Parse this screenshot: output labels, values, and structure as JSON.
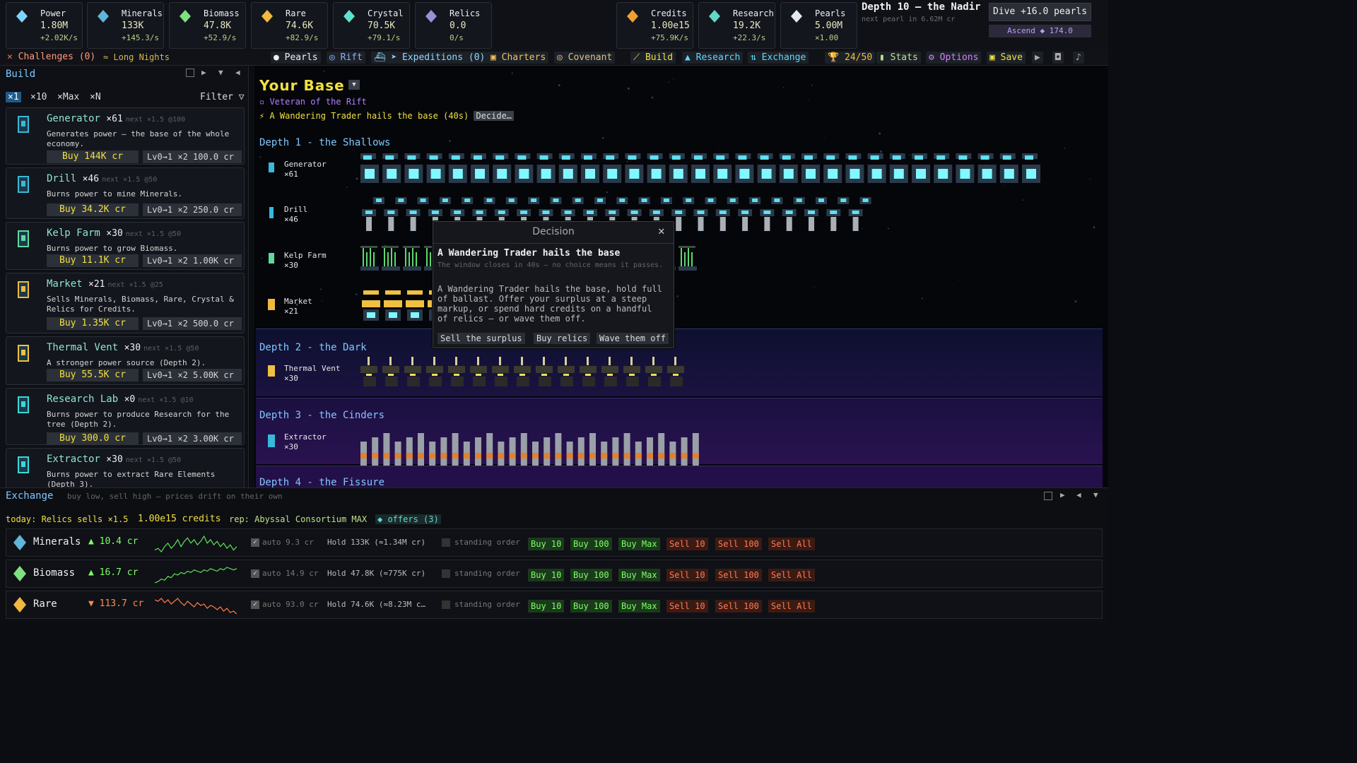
{
  "resources": [
    {
      "name": "Power",
      "value": "1.80M",
      "rate": "+2.02K/s",
      "icon": "lightning-icon",
      "color": "#7fd4ff"
    },
    {
      "name": "Minerals",
      "value": "133K",
      "rate": "+145.3/s",
      "icon": "mineral-crystal-icon",
      "color": "#5fb6d8"
    },
    {
      "name": "Biomass",
      "value": "47.8K",
      "rate": "+52.9/s",
      "icon": "kelp-icon",
      "color": "#7fe07f"
    },
    {
      "name": "Rare",
      "value": "74.6K",
      "rate": "+82.9/s",
      "icon": "rare-orb-icon",
      "color": "#f0b840"
    },
    {
      "name": "Crystal",
      "value": "70.5K",
      "rate": "+79.1/s",
      "icon": "crystal-icon",
      "color": "#5fe0d0"
    },
    {
      "name": "Relics",
      "value": "0.0",
      "rate": "0/s",
      "icon": "relic-icon",
      "color": "#9a8fd8"
    },
    {
      "name": "Credits",
      "value": "1.00e15",
      "rate": "+75.9K/s",
      "icon": "credit-coin-icon",
      "color": "#f0a030"
    },
    {
      "name": "Research",
      "value": "19.2K",
      "rate": "+22.3/s",
      "icon": "flask-icon",
      "color": "#5fd8c8"
    },
    {
      "name": "Pearls",
      "value": "5.00M",
      "rate": "×1.00",
      "icon": "pearl-icon",
      "color": "#e0e8f0"
    }
  ],
  "depth": {
    "title": "Depth 10 — the Nadir",
    "next": "next pearl in 6.62M cr",
    "dive": "Dive  +16.0 pearls",
    "ascend": "Ascend  ◆ 174.0"
  },
  "subbar": {
    "challenges": "Challenges (0)",
    "long_nights": "≈ Long Nights",
    "pearls": "Pearls",
    "rift": "Rift",
    "expeditions": "Expeditions (0)",
    "charters": "Charters",
    "covenant": "Covenant",
    "build": "Build",
    "research": "Research",
    "exchange": "Exchange",
    "trophies": "24/50",
    "stats": "Stats",
    "options": "Options",
    "save": "Save"
  },
  "build_panel": {
    "title": "Build",
    "multipliers": [
      "×1",
      "×10",
      "×Max",
      "×N"
    ],
    "filter": "Filter ▽",
    "cards": [
      {
        "name": "Generator",
        "count": "×61",
        "next": "next ×1.5 @100",
        "desc": "Generates power — the base of the whole economy.",
        "buy": "Buy 144K cr",
        "lv": "Lv0→1 ×2  100.0 cr",
        "icon": "generator-icon"
      },
      {
        "name": "Drill",
        "count": "×46",
        "next": "next ×1.5 @50",
        "desc": "Burns power to mine Minerals.",
        "buy": "Buy 34.2K cr",
        "lv": "Lv0→1 ×2  250.0 cr",
        "icon": "drill-icon"
      },
      {
        "name": "Kelp Farm",
        "count": "×30",
        "next": "next ×1.5 @50",
        "desc": "Burns power to grow Biomass.",
        "buy": "Buy 11.1K cr",
        "lv": "Lv0→1 ×2  1.00K cr",
        "icon": "kelp-farm-icon"
      },
      {
        "name": "Market",
        "count": "×21",
        "next": "next ×1.5 @25",
        "desc": "Sells Minerals, Biomass, Rare, Crystal & Relics for Credits.",
        "buy": "Buy 1.35K cr",
        "lv": "Lv0→1 ×2  500.0 cr",
        "icon": "market-icon"
      },
      {
        "name": "Thermal Vent",
        "count": "×30",
        "next": "next ×1.5 @50",
        "desc": "A stronger power source (Depth 2).",
        "buy": "Buy 55.5K cr",
        "lv": "Lv0→1 ×2  5.00K cr",
        "icon": "thermal-vent-icon"
      },
      {
        "name": "Research Lab",
        "count": "×0",
        "next": "next ×1.5 @10",
        "desc": "Burns power to produce Research for the tree (Depth 2).",
        "buy": "Buy 300.0 cr",
        "lv": "Lv0→1 ×2  3.00K cr",
        "icon": "research-lab-icon"
      },
      {
        "name": "Extractor",
        "count": "×30",
        "next": "next ×1.5 @50",
        "desc": "Burns power to extract Rare Elements (Depth 3).",
        "buy": "",
        "lv": "",
        "icon": "extractor-icon"
      }
    ]
  },
  "base": {
    "title": "Your Base",
    "veteran": "Veteran of the Rift",
    "event": "A Wandering Trader hails the base (40s)",
    "decide": "Decide…",
    "depths": [
      {
        "title": "Depth 1 - the Shallows",
        "rows": [
          {
            "name": "Generator",
            "count": "×61"
          },
          {
            "name": "Drill",
            "count": "×46"
          },
          {
            "name": "Kelp Farm",
            "count": "×30"
          },
          {
            "name": "Market",
            "count": "×21"
          }
        ]
      },
      {
        "title": "Depth 2 - the Dark",
        "rows": [
          {
            "name": "Thermal Vent",
            "count": "×30"
          }
        ]
      },
      {
        "title": "Depth 3 - the Cinders",
        "rows": [
          {
            "name": "Extractor",
            "count": "×30"
          }
        ]
      },
      {
        "title": "Depth 4 - the Fissure",
        "rows": []
      }
    ]
  },
  "dialog": {
    "header": "Decision",
    "title": "A Wandering Trader hails the base",
    "timer": "The window closes in 40s — no choice means it passes.",
    "body": "A Wandering Trader hails the base, hold full of ballast. Offer your surplus at a steep markup, or spend hard credits on a handful of relics — or wave them off.",
    "options": [
      "Sell the surplus",
      "Buy relics",
      "Wave them off"
    ]
  },
  "exchange": {
    "title": "Exchange",
    "subtitle": "buy low, sell high — prices drift on their own",
    "today": "today: Relics sells ×1.5",
    "credits": "1.00e15 credits",
    "rep": "rep: Abyssal Consortium MAX",
    "offers": "◆ offers (3)",
    "rows": [
      {
        "name": "Minerals",
        "dir": "▲",
        "price": "10.4 cr",
        "auto": "auto 9.3 cr",
        "hold": "Hold 133K  (≈1.34M cr)",
        "standing": "standing order",
        "trend": "up",
        "icon": "mineral-crystal-icon",
        "spark": [
          8,
          9,
          7,
          10,
          12,
          9,
          11,
          14,
          10,
          13,
          15,
          12,
          14,
          11,
          13,
          16,
          12,
          14,
          11,
          13,
          10,
          12,
          9,
          11,
          8,
          10
        ]
      },
      {
        "name": "Biomass",
        "dir": "▲",
        "price": "16.7 cr",
        "auto": "auto 14.9 cr",
        "hold": "Hold 47.8K  (≈775K cr)",
        "standing": "standing order",
        "trend": "up",
        "icon": "kelp-icon",
        "spark": [
          4,
          5,
          7,
          6,
          9,
          8,
          11,
          10,
          12,
          11,
          13,
          12,
          14,
          13,
          12,
          14,
          13,
          15,
          14,
          13,
          15,
          14,
          16,
          15,
          14,
          15
        ]
      },
      {
        "name": "Rare",
        "dir": "▼",
        "price": "113.7 cr",
        "auto": "auto 93.0 cr",
        "hold": "Hold 74.6K  (≈8.23M c…",
        "standing": "standing order",
        "trend": "down",
        "icon": "rare-orb-icon",
        "spark": [
          14,
          13,
          15,
          12,
          14,
          11,
          13,
          15,
          12,
          10,
          13,
          11,
          9,
          12,
          10,
          11,
          8,
          10,
          9,
          7,
          9,
          6,
          8,
          5,
          6,
          4
        ]
      }
    ],
    "buttons": {
      "buy10": "Buy 10",
      "buy100": "Buy 100",
      "buymax": "Buy Max",
      "sell10": "Sell 10",
      "sell100": "Sell 100",
      "sellall": "Sell All"
    }
  }
}
